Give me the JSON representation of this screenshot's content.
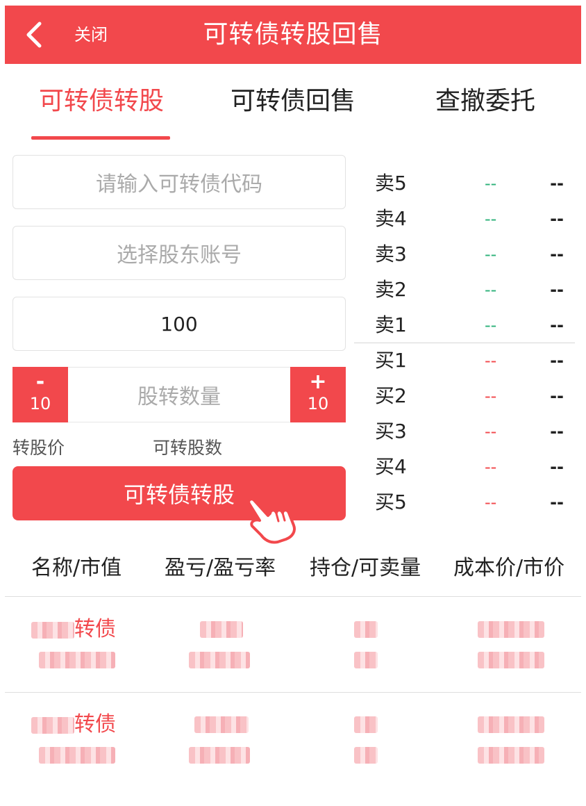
{
  "header": {
    "back_icon": "chevron-left-icon",
    "close_label": "关闭",
    "title": "可转债转股回售",
    "bg_color": "#f2484c"
  },
  "tabs": [
    {
      "label": "可转债转股",
      "active": true
    },
    {
      "label": "可转债回售",
      "active": false
    },
    {
      "label": "查撤委托",
      "active": false
    }
  ],
  "form": {
    "code_placeholder": "请输入可转债代码",
    "account_placeholder": "选择股东账号",
    "price_value": "100",
    "qty_placeholder": "股转数量",
    "minus_symbol": "-",
    "minus_step": "10",
    "plus_symbol": "+",
    "plus_step": "10",
    "convert_price_label": "转股价",
    "convertible_qty_label": "可转股数",
    "submit_label": "可转债转股"
  },
  "order_book": {
    "sell": [
      {
        "label": "卖5",
        "price": "--",
        "volume": "--"
      },
      {
        "label": "卖4",
        "price": "--",
        "volume": "--"
      },
      {
        "label": "卖3",
        "price": "--",
        "volume": "--"
      },
      {
        "label": "卖2",
        "price": "--",
        "volume": "--"
      },
      {
        "label": "卖1",
        "price": "--",
        "volume": "--"
      }
    ],
    "buy": [
      {
        "label": "买1",
        "price": "--",
        "volume": "--"
      },
      {
        "label": "买2",
        "price": "--",
        "volume": "--"
      },
      {
        "label": "买3",
        "price": "--",
        "volume": "--"
      },
      {
        "label": "买4",
        "price": "--",
        "volume": "--"
      },
      {
        "label": "买5",
        "price": "--",
        "volume": "--"
      }
    ],
    "sell_color": "#2db27a",
    "buy_color": "#f2484c"
  },
  "holdings": {
    "headers": [
      "名称/市值",
      "盈亏/盈亏率",
      "持仓/可卖量",
      "成本价/市价"
    ],
    "rows": [
      {
        "name_suffix": "转债"
      },
      {
        "name_suffix": "转债"
      }
    ]
  }
}
